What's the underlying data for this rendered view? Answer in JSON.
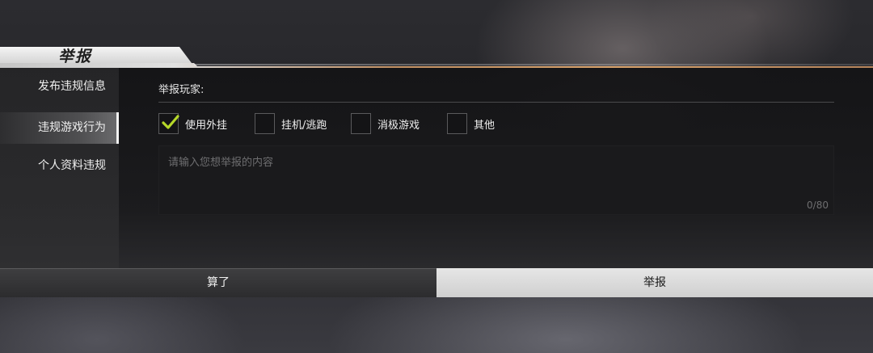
{
  "dialog": {
    "title": "举报"
  },
  "sidebar": {
    "items": [
      {
        "label": "发布违规信息",
        "active": false
      },
      {
        "label": "违规游戏行为",
        "active": true
      },
      {
        "label": "个人资料违规",
        "active": false
      }
    ]
  },
  "form": {
    "report_player_label": "举报玩家:",
    "options": [
      {
        "label": "使用外挂",
        "checked": true
      },
      {
        "label": "挂机/逃跑",
        "checked": false
      },
      {
        "label": "消极游戏",
        "checked": false
      },
      {
        "label": "其他",
        "checked": false
      }
    ],
    "input": {
      "placeholder": "请输入您想举报的内容",
      "counter": "0/80"
    }
  },
  "footer": {
    "cancel_label": "算了",
    "submit_label": "举报"
  },
  "colors": {
    "accent_check": "#b6d829",
    "accent_line": "#d9a36b"
  }
}
